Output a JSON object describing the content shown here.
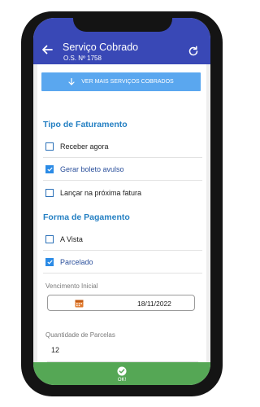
{
  "header": {
    "title": "Serviço Cobrado",
    "subtitle": "O.S. Nº 1758"
  },
  "more_services_button": "VER MAIS SERVIÇOS COBRADOS",
  "billing": {
    "title": "Tipo de Faturamento",
    "options": [
      {
        "label": "Receber agora",
        "checked": false
      },
      {
        "label": "Gerar boleto avulso",
        "checked": true
      },
      {
        "label": "Lançar na próxima fatura",
        "checked": false
      }
    ]
  },
  "payment": {
    "title": "Forma de Pagamento",
    "options": [
      {
        "label": "A Vista",
        "checked": false
      },
      {
        "label": "Parcelado",
        "checked": true
      }
    ]
  },
  "due_date": {
    "label": "Vencimento Inicial",
    "value": "18/11/2022"
  },
  "installments": {
    "label": "Quantidade de Parcelas",
    "value": "12"
  },
  "ok_label": "OK!",
  "colors": {
    "header": "#3948b6",
    "accent": "#2b8be6",
    "ok_bar": "#55a755"
  },
  "icons": [
    "arrow-left-icon",
    "refresh-icon",
    "arrow-down-icon",
    "calendar-icon",
    "check-circle-icon"
  ]
}
